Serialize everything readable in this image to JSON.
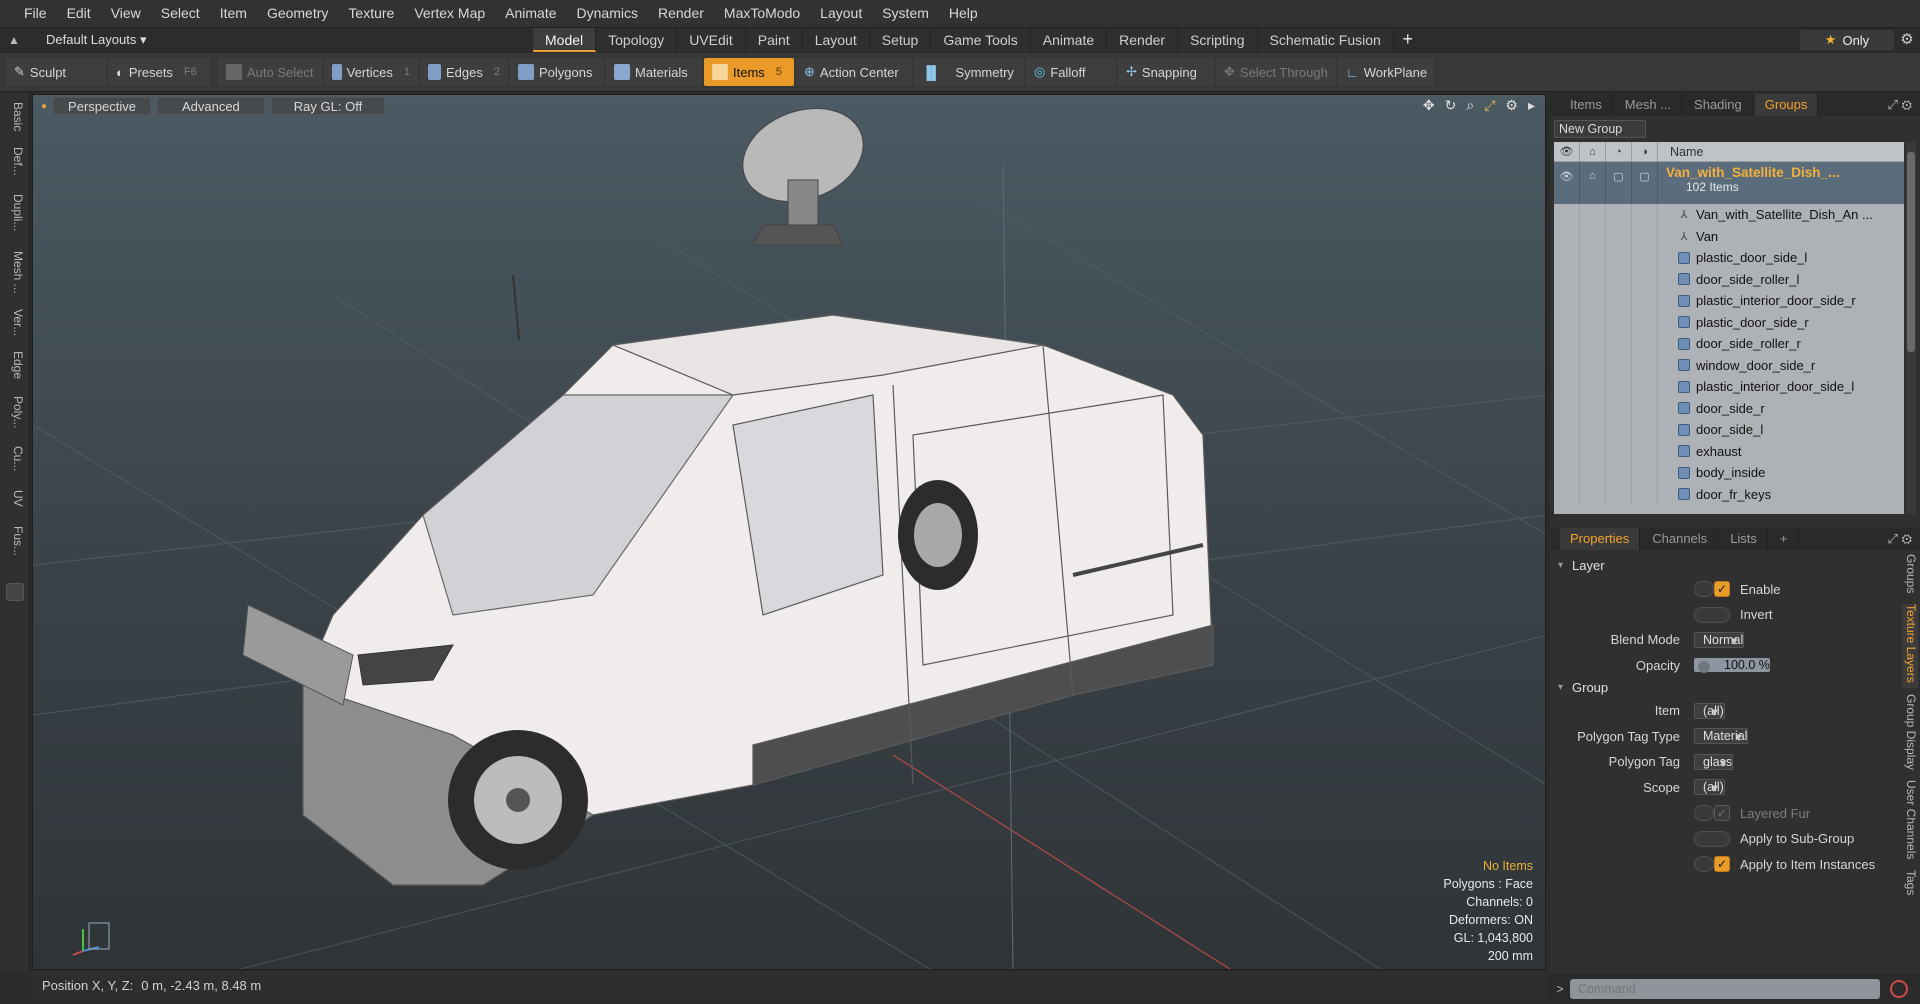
{
  "menu": [
    "File",
    "Edit",
    "View",
    "Select",
    "Item",
    "Geometry",
    "Texture",
    "Vertex Map",
    "Animate",
    "Dynamics",
    "Render",
    "MaxToModo",
    "Layout",
    "System",
    "Help"
  ],
  "layout_select": "Default Layouts ▾",
  "layout_tabs": [
    {
      "label": "Model",
      "active": true
    },
    {
      "label": "Topology"
    },
    {
      "label": "UVEdit"
    },
    {
      "label": "Paint"
    },
    {
      "label": "Layout"
    },
    {
      "label": "Setup"
    },
    {
      "label": "Game Tools"
    },
    {
      "label": "Animate"
    },
    {
      "label": "Render"
    },
    {
      "label": "Scripting"
    },
    {
      "label": "Schematic Fusion"
    }
  ],
  "only_label": "Only",
  "toolbar": {
    "sculpt": "Sculpt",
    "presets": "Presets",
    "presets_key": "F6",
    "auto_select": "Auto Select",
    "vertices": "Vertices",
    "vertices_key": "1",
    "edges": "Edges",
    "edges_key": "2",
    "polygons": "Polygons",
    "materials": "Materials",
    "items": "Items",
    "items_key": "5",
    "action_center": "Action Center",
    "symmetry": "Symmetry",
    "falloff": "Falloff",
    "snapping": "Snapping",
    "select_through": "Select Through",
    "workplane": "WorkPlane"
  },
  "left_tabs": [
    "Basic",
    "Def...",
    "Dupli...",
    "Mesh ...",
    "Ver...",
    "Edge",
    "Poly...",
    "Cu...",
    "UV",
    "Fus..."
  ],
  "viewport": {
    "perspective": "Perspective",
    "advanced": "Advanced",
    "raygl": "Ray GL: Off",
    "stats": {
      "no_items": "No Items",
      "polygons": "Polygons : Face",
      "channels": "Channels: 0",
      "deformers": "Deformers: ON",
      "gl": "GL: 1,043,800",
      "scale": "200 mm"
    }
  },
  "status": {
    "label": "Position X, Y, Z:",
    "value": "0 m, -2.43 m, 8.48 m"
  },
  "groups_panel": {
    "tabs": [
      {
        "label": "Items"
      },
      {
        "label": "Mesh ..."
      },
      {
        "label": "Shading"
      },
      {
        "label": "Groups",
        "active": true
      }
    ],
    "new_group": "New Group",
    "header_name": "Name",
    "root": {
      "name": "Van_with_Satellite_Dish_...",
      "count": "102 Items"
    },
    "items": [
      {
        "name": "Van_with_Satellite_Dish_An ...",
        "kind": "locator"
      },
      {
        "name": "Van",
        "kind": "locator"
      },
      {
        "name": "plastic_door_side_l",
        "kind": "mesh"
      },
      {
        "name": "door_side_roller_l",
        "kind": "mesh"
      },
      {
        "name": "plastic_interior_door_side_r",
        "kind": "mesh"
      },
      {
        "name": "plastic_door_side_r",
        "kind": "mesh"
      },
      {
        "name": "door_side_roller_r",
        "kind": "mesh"
      },
      {
        "name": "window_door_side_r",
        "kind": "mesh"
      },
      {
        "name": "plastic_interior_door_side_l",
        "kind": "mesh"
      },
      {
        "name": "door_side_r",
        "kind": "mesh"
      },
      {
        "name": "door_side_l",
        "kind": "mesh"
      },
      {
        "name": "exhaust",
        "kind": "mesh"
      },
      {
        "name": "body_inside",
        "kind": "mesh"
      },
      {
        "name": "door_fr_keys",
        "kind": "mesh"
      }
    ]
  },
  "props_panel": {
    "tabs": [
      {
        "label": "Properties",
        "active": true
      },
      {
        "label": "Channels"
      },
      {
        "label": "Lists"
      }
    ],
    "layer_section": "Layer",
    "enable": "Enable",
    "invert": "Invert",
    "blend_mode_label": "Blend Mode",
    "blend_mode": "Normal",
    "opacity_label": "Opacity",
    "opacity": "100.0 %",
    "group_section": "Group",
    "item_label": "Item",
    "item_value": "(all)",
    "poly_tag_type_label": "Polygon Tag Type",
    "poly_tag_type": "Material",
    "poly_tag_label": "Polygon Tag",
    "poly_tag": "glass",
    "scope_label": "Scope",
    "scope": "(all)",
    "layered_fur": "Layered Fur",
    "apply_sub_group": "Apply to Sub-Group",
    "apply_instances": "Apply to Item Instances"
  },
  "right_vtabs": [
    {
      "label": "Groups"
    },
    {
      "label": "Texture Layers",
      "active": true
    },
    {
      "label": "Group Display"
    },
    {
      "label": "User Channels"
    },
    {
      "label": "Tags"
    }
  ],
  "command_placeholder": "Command",
  "colors": {
    "accent": "#e99a28",
    "tree_bg": "#aeb2b6",
    "root_row": "#5b6d7c"
  }
}
